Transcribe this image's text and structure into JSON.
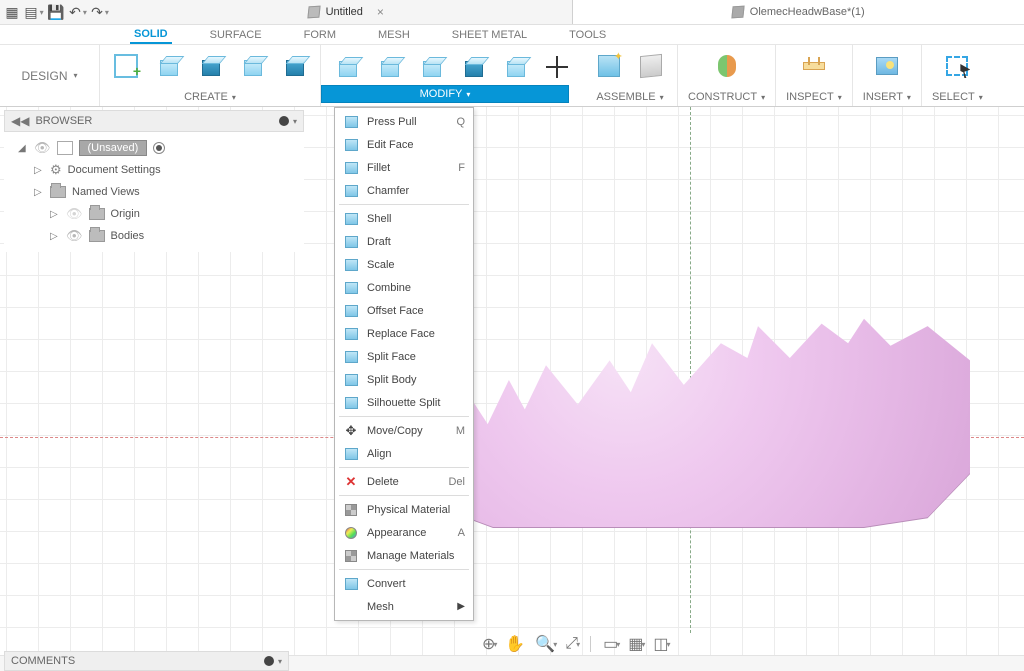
{
  "topbar": {
    "apps_label": "apps-grid",
    "tabs": [
      {
        "title": "Untitled",
        "active": true
      },
      {
        "title": "OlemecHeadwBase*(1)",
        "active": false
      }
    ]
  },
  "design_label": "DESIGN",
  "workspace_tabs": [
    "SOLID",
    "SURFACE",
    "FORM",
    "MESH",
    "SHEET METAL",
    "TOOLS"
  ],
  "active_workspace_tab": "SOLID",
  "ribbon": {
    "create": "CREATE",
    "modify": "MODIFY",
    "assemble": "ASSEMBLE",
    "construct": "CONSTRUCT",
    "inspect": "INSPECT",
    "insert": "INSERT",
    "select": "SELECT"
  },
  "browser": {
    "title": "BROWSER",
    "root": "(Unsaved)",
    "items": [
      {
        "label": "Document Settings",
        "icon": "gear"
      },
      {
        "label": "Named Views",
        "icon": "folder"
      },
      {
        "label": "Origin",
        "icon": "folder",
        "indent": true
      },
      {
        "label": "Bodies",
        "icon": "folder",
        "indent": true
      }
    ]
  },
  "modify_menu": {
    "items": [
      {
        "label": "Press Pull",
        "shortcut": "Q",
        "icon": "cube"
      },
      {
        "label": "Edit Face",
        "icon": "cube"
      },
      {
        "label": "Fillet",
        "shortcut": "F",
        "icon": "cube"
      },
      {
        "label": "Chamfer",
        "icon": "cube"
      },
      {
        "sep": true
      },
      {
        "label": "Shell",
        "icon": "cube"
      },
      {
        "label": "Draft",
        "icon": "cube"
      },
      {
        "label": "Scale",
        "icon": "cube"
      },
      {
        "label": "Combine",
        "icon": "cube"
      },
      {
        "label": "Offset Face",
        "icon": "cube"
      },
      {
        "label": "Replace Face",
        "icon": "cube"
      },
      {
        "label": "Split Face",
        "icon": "cube"
      },
      {
        "label": "Split Body",
        "icon": "cube"
      },
      {
        "label": "Silhouette Split",
        "icon": "cube"
      },
      {
        "sep": true
      },
      {
        "label": "Move/Copy",
        "shortcut": "M",
        "icon": "move"
      },
      {
        "label": "Align",
        "icon": "cube"
      },
      {
        "sep": true
      },
      {
        "label": "Delete",
        "shortcut": "Del",
        "icon": "x"
      },
      {
        "sep": true
      },
      {
        "label": "Physical Material",
        "icon": "grid"
      },
      {
        "label": "Appearance",
        "shortcut": "A",
        "icon": "round"
      },
      {
        "label": "Manage Materials",
        "icon": "grid"
      },
      {
        "sep": true
      },
      {
        "label": "Convert",
        "icon": "cube"
      },
      {
        "label": "Mesh",
        "submenu": true
      }
    ]
  },
  "comments_label": "COMMENTS"
}
